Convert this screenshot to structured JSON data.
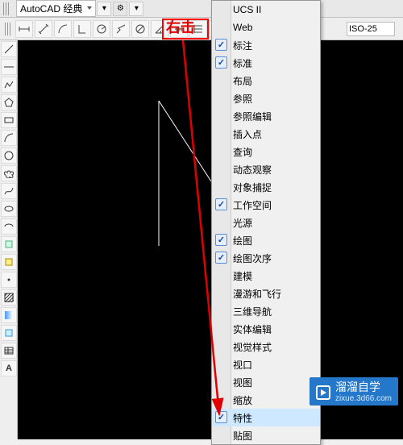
{
  "workspace": {
    "label": "AutoCAD 经典"
  },
  "iso_value": "ISO-25",
  "annotation_text": "右击",
  "menu": {
    "items": [
      {
        "label": "UCS II",
        "checked": false
      },
      {
        "label": "Web",
        "checked": false
      },
      {
        "label": "标注",
        "checked": true
      },
      {
        "label": "标准",
        "checked": true
      },
      {
        "label": "布局",
        "checked": false
      },
      {
        "label": "参照",
        "checked": false
      },
      {
        "label": "参照编辑",
        "checked": false
      },
      {
        "label": "插入点",
        "checked": false
      },
      {
        "label": "查询",
        "checked": false
      },
      {
        "label": "动态观察",
        "checked": false
      },
      {
        "label": "对象捕捉",
        "checked": false
      },
      {
        "label": "工作空间",
        "checked": true
      },
      {
        "label": "光源",
        "checked": false
      },
      {
        "label": "绘图",
        "checked": true
      },
      {
        "label": "绘图次序",
        "checked": true
      },
      {
        "label": "建模",
        "checked": false
      },
      {
        "label": "漫游和飞行",
        "checked": false
      },
      {
        "label": "三维导航",
        "checked": false
      },
      {
        "label": "实体编辑",
        "checked": false
      },
      {
        "label": "视觉样式",
        "checked": false
      },
      {
        "label": "视口",
        "checked": false
      },
      {
        "label": "视图",
        "checked": false
      },
      {
        "label": "缩放",
        "checked": false
      },
      {
        "label": "特性",
        "checked": true,
        "highlight": true
      },
      {
        "label": "贴图",
        "checked": false
      }
    ]
  },
  "watermark": {
    "brand": "溜溜自学",
    "url": "zixue.3d66.com"
  },
  "left_tools": [
    "line",
    "cline",
    "pline",
    "poly",
    "rect",
    "arc",
    "circ",
    "spl",
    "ell",
    "ell2",
    "blk",
    "pt",
    "hat",
    "grad",
    "reg",
    "tab",
    "txt",
    "txt2"
  ],
  "top_tools": [
    "dist",
    "ang",
    "pan",
    "sel",
    "zoom",
    "grid",
    "circ",
    "arc",
    "arrow",
    "cam"
  ]
}
